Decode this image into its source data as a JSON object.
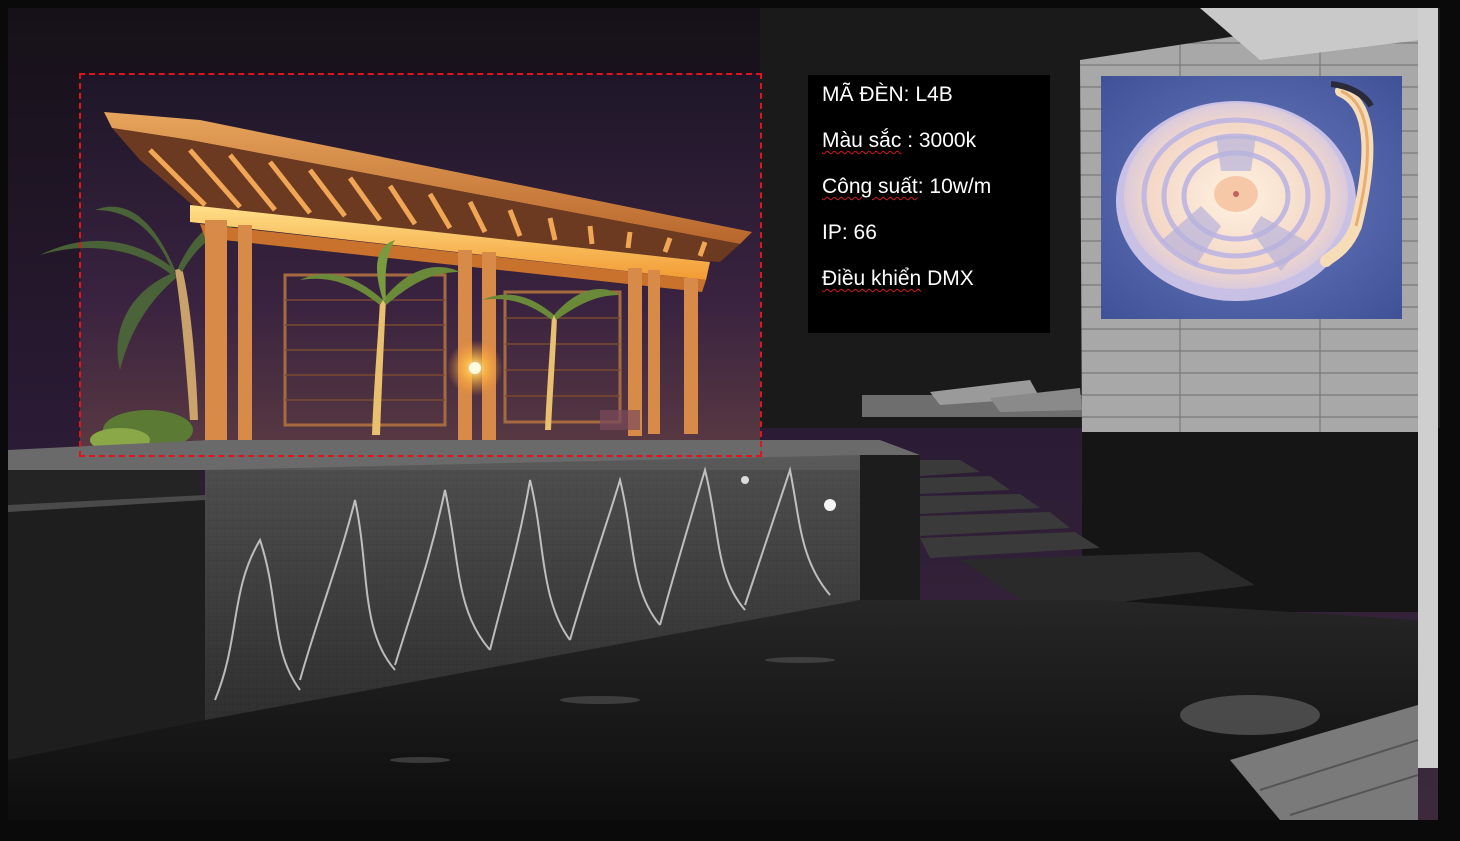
{
  "spec_panel": {
    "code_label": "MÃ ĐÈN: L4B",
    "color_prefix": "Màu sắc",
    "color_value": " : 3000k",
    "power_prefix": "Công suất",
    "power_value": ": 10w/m",
    "ip_label": "IP: 66",
    "control_prefix": "Điều khiển",
    "control_value": " DMX"
  },
  "colors": {
    "highlight_box": "#e0151b",
    "warm_light": "#f0a040",
    "sky": "#2a1a3a",
    "product_bg": "#4a5ea8"
  },
  "icons": {
    "focus_box": "red-dashed-rectangle",
    "product": "led-neon-strip-reel"
  }
}
